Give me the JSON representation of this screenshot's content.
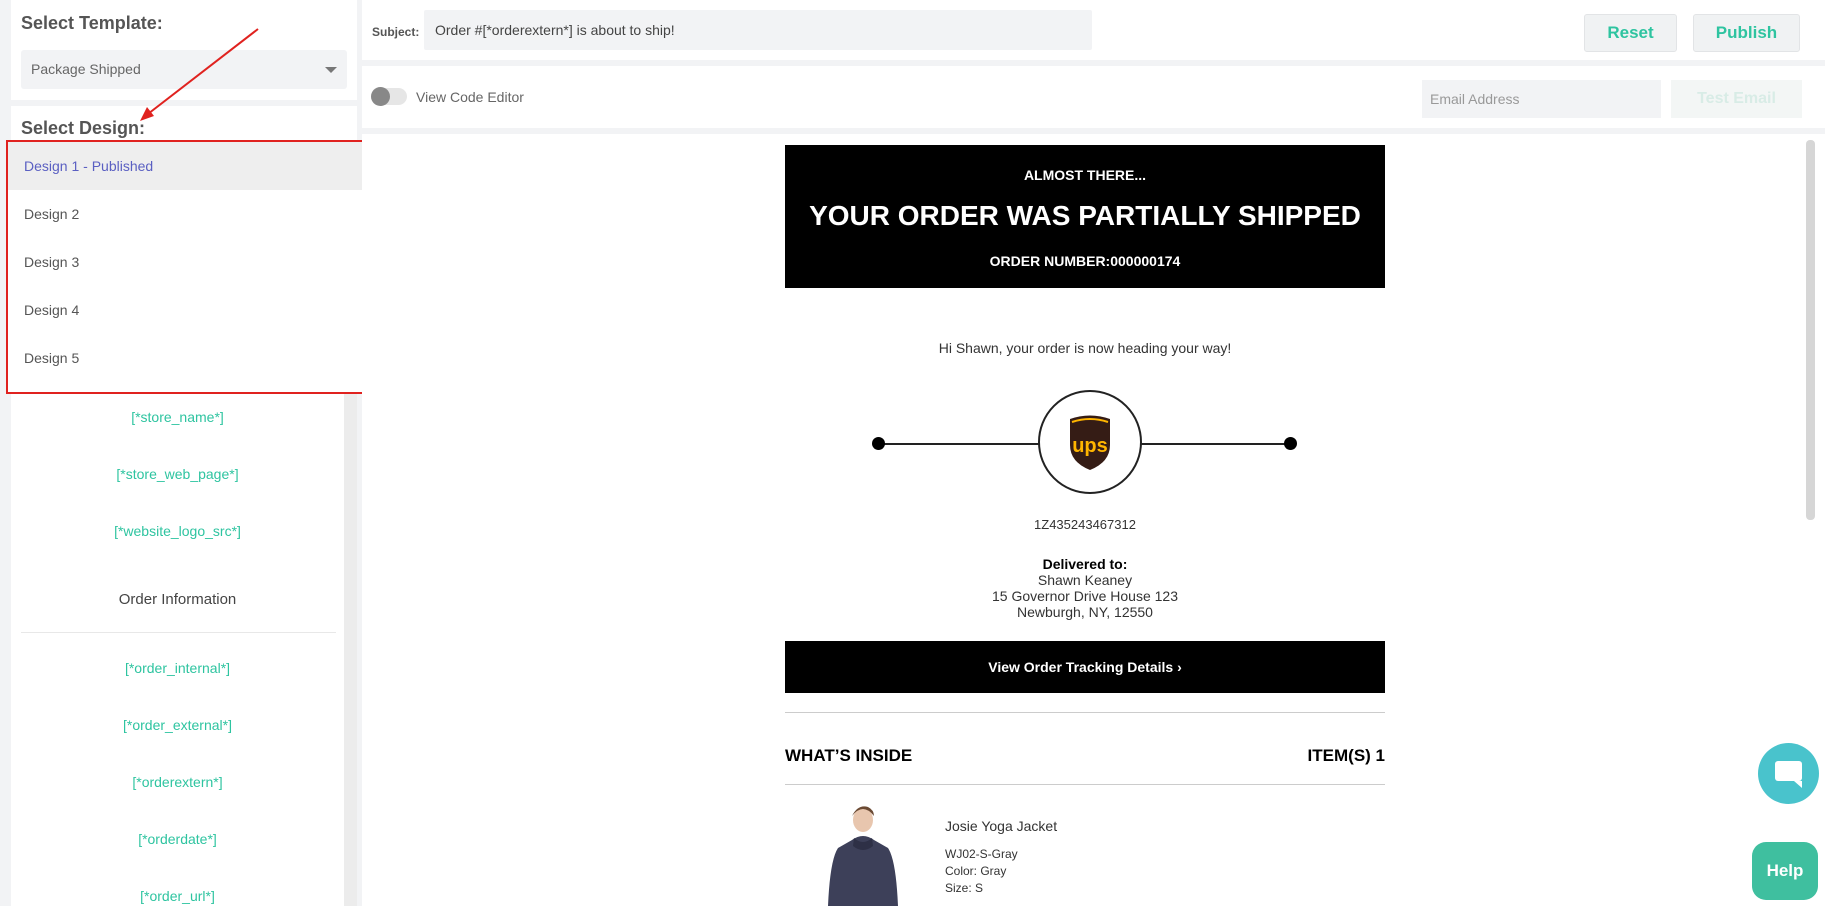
{
  "sidebar": {
    "template_heading": "Select Template:",
    "template_value": "Package Shipped",
    "design_heading": "Select Design:",
    "design_options": [
      {
        "label": "Design 1 - Published",
        "selected": true
      },
      {
        "label": "Design 2"
      },
      {
        "label": "Design 3"
      },
      {
        "label": "Design 4"
      },
      {
        "label": "Design 5"
      }
    ],
    "variables_store": [
      "[*store_name*]",
      "[*store_web_page*]",
      "[*website_logo_src*]"
    ],
    "order_section_title": "Order Information",
    "variables_order": [
      "[*order_internal*]",
      "[*order_external*]",
      "[*orderextern*]",
      "[*orderdate*]",
      "[*order_url*]"
    ]
  },
  "header": {
    "subject_label": "Subject:",
    "subject_value": "Order #[*orderextern*] is about to ship!",
    "reset_label": "Reset",
    "publish_label": "Publish"
  },
  "toolbar": {
    "code_editor_label": "View Code Editor",
    "code_editor_on": false,
    "email_placeholder": "Email Address",
    "test_email_label": "Test Email"
  },
  "email": {
    "kicker": "ALMOST THERE...",
    "title": "YOUR ORDER WAS PARTIALLY SHIPPED",
    "order_number": "ORDER NUMBER:000000174",
    "greeting": "Hi Shawn, your order is now heading your way!",
    "carrier": "ups",
    "tracking_number": "1Z435243467312",
    "delivered_title": "Delivered to:",
    "delivered_name": "Shawn Keaney",
    "delivered_street": "15 Governor Drive House 123",
    "delivered_city": "Newburgh, NY, 12550",
    "track_button": "View Order Tracking Details ›",
    "inside_title": "WHAT’S INSIDE",
    "inside_count": "ITEM(S) 1",
    "product": {
      "name": "Josie Yoga Jacket",
      "sku": "WJ02-S-Gray",
      "color": "Color: Gray",
      "size": "Size: S"
    }
  },
  "widgets": {
    "help_label": "Help"
  },
  "colors": {
    "accent": "#2ec4a0",
    "annotation": "#e0221f",
    "selected_option": "#5a5fc2",
    "ups_brown": "#351c15",
    "ups_gold": "#ffb500"
  }
}
